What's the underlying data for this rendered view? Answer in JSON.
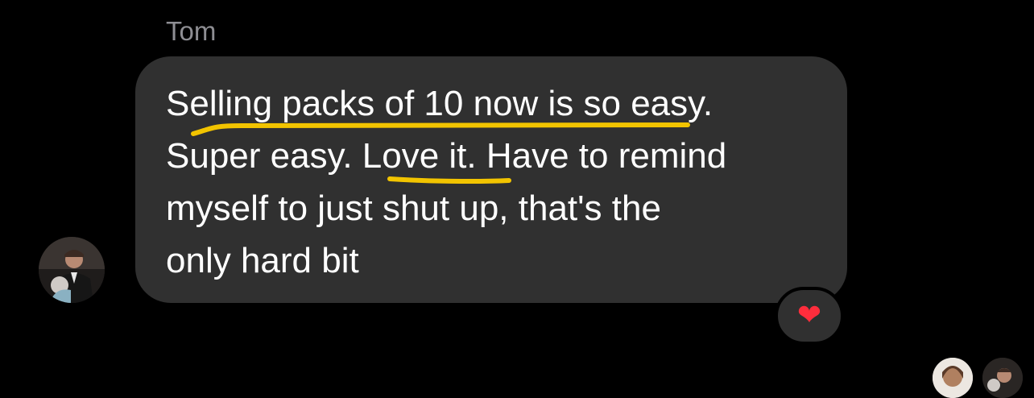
{
  "sender": {
    "name": "Tom"
  },
  "message": {
    "lines": [
      "Selling packs of 10 now is so easy.",
      "Super easy. Love it. Have to remind",
      "myself to just shut up, that's the",
      "only hard bit"
    ]
  },
  "reaction": {
    "glyph": "❤",
    "icon": "red-heart-icon",
    "color": "#ff2d3c"
  },
  "read_receipts": {
    "icons": [
      "reader-avatar",
      "reader-avatar"
    ]
  },
  "colors": {
    "background": "#000000",
    "bubble": "#303030",
    "text": "#ffffff",
    "sender_name": "#8e8e93",
    "underline_highlight": "#f2c400"
  }
}
